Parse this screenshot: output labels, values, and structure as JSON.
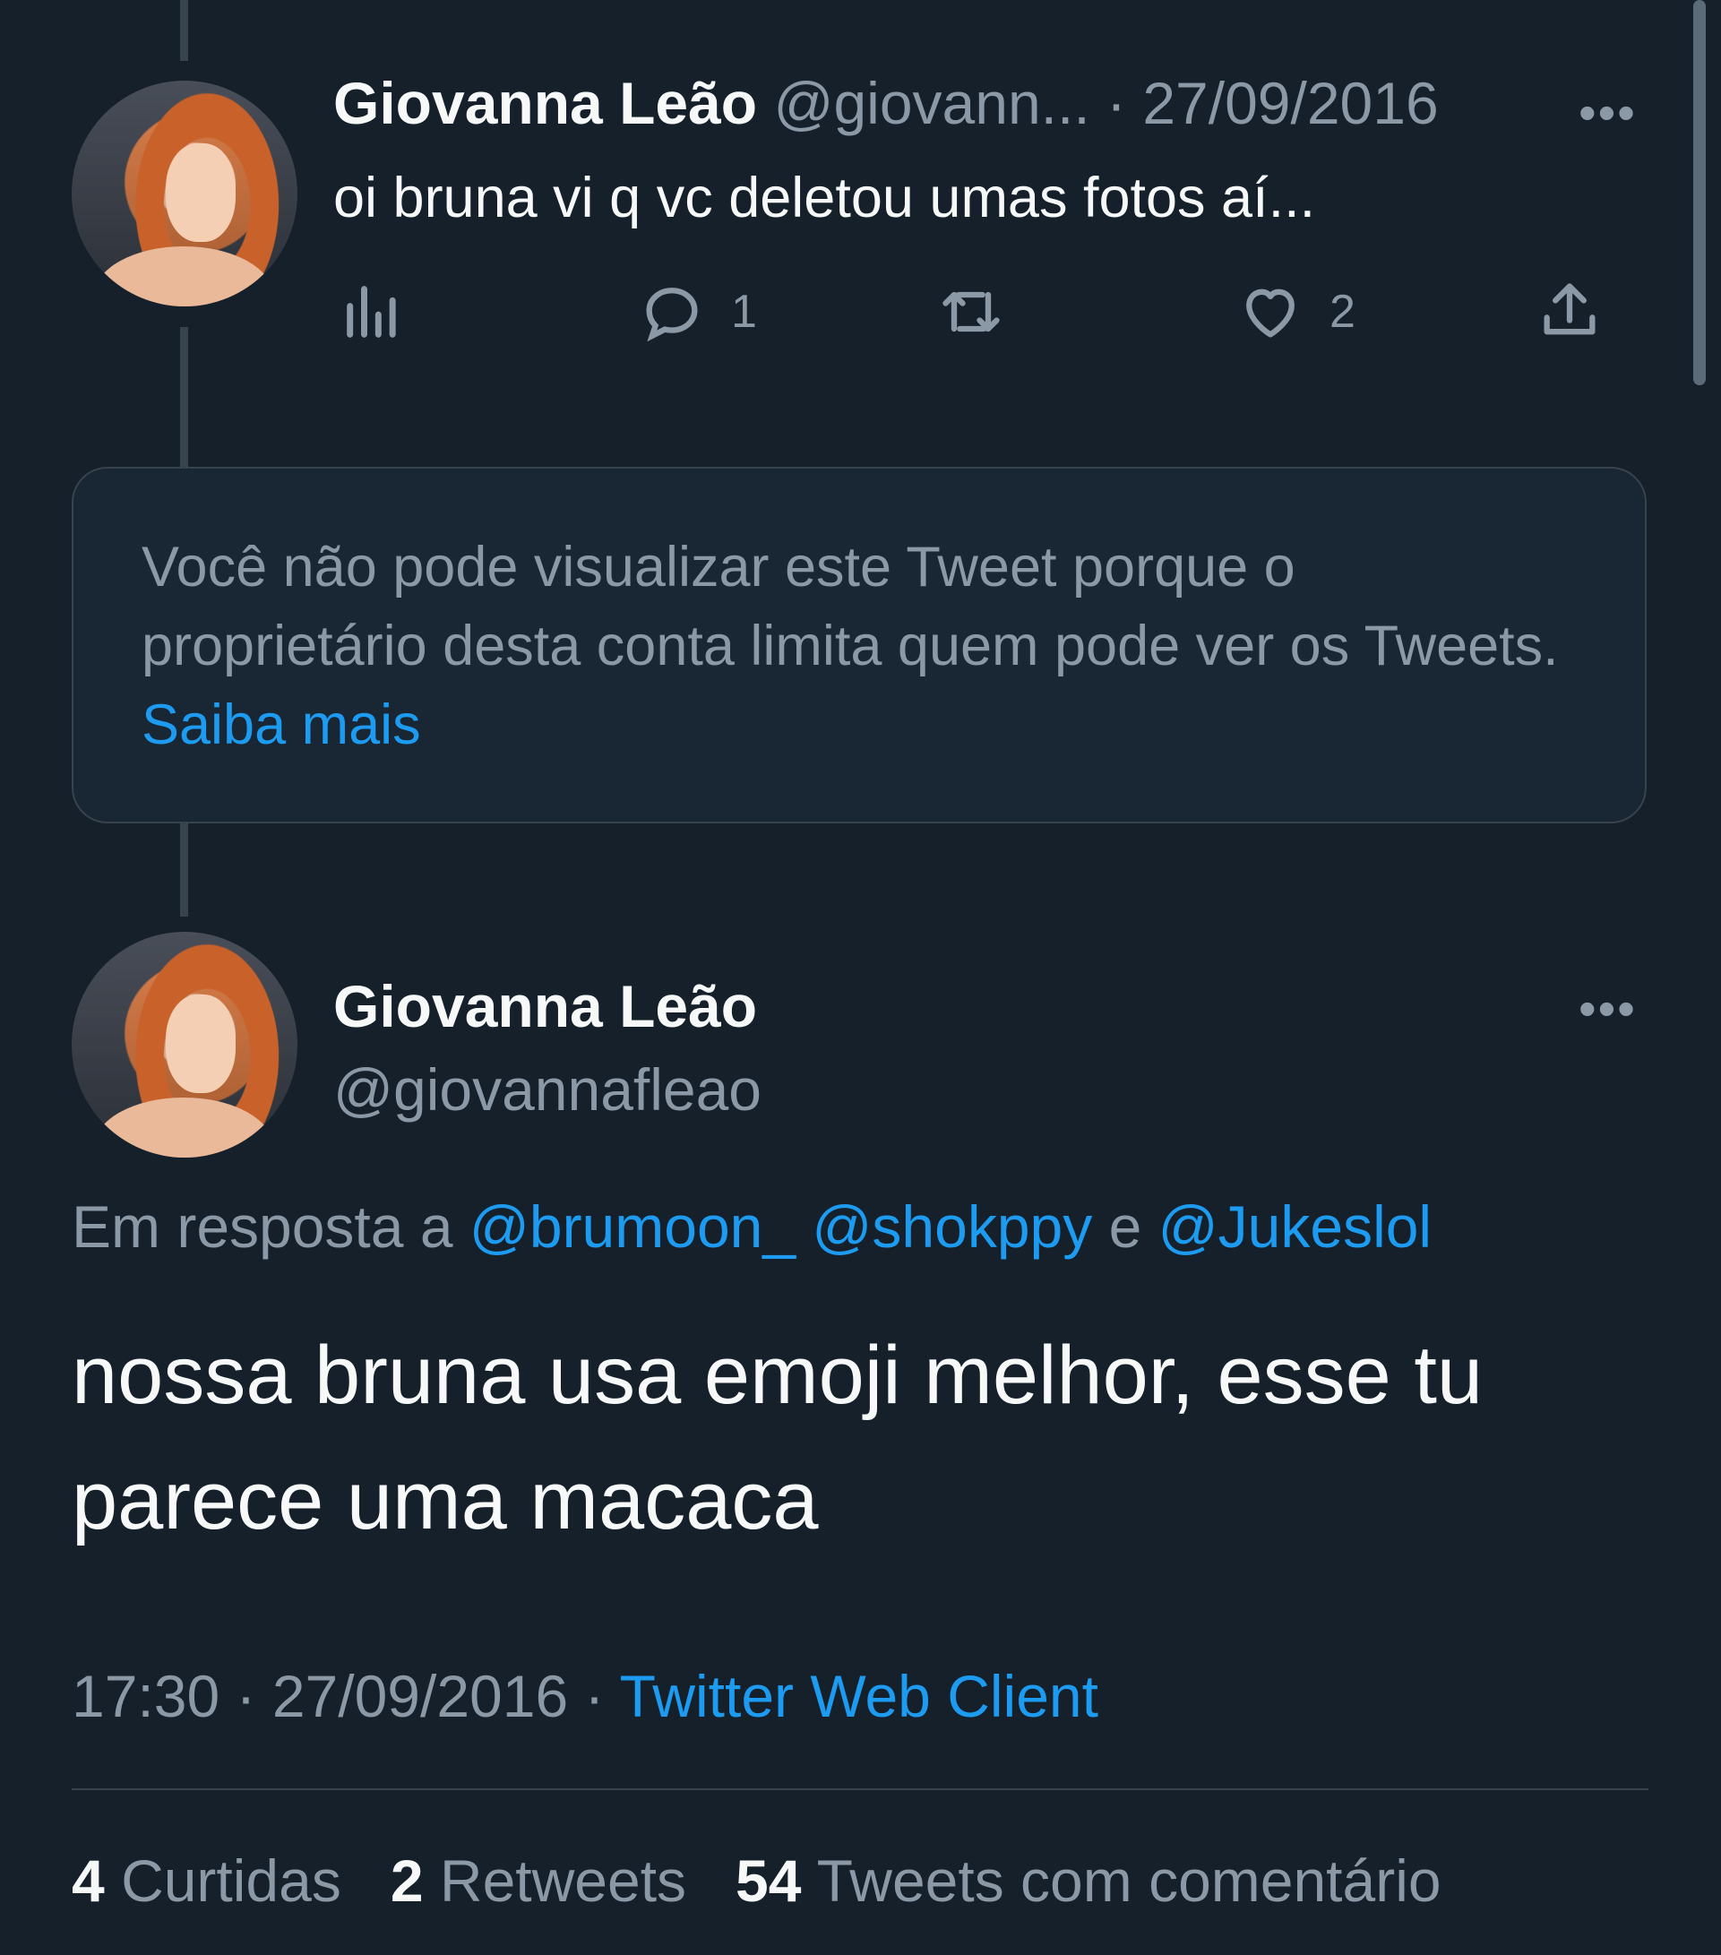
{
  "tweet1": {
    "name": "Giovanna Leão",
    "handle": "@giovann...",
    "date": "· 27/09/2016",
    "text": "oi bruna vi q vc deletou umas fotos aí...",
    "replies": "1",
    "likes": "2",
    "more": "•••"
  },
  "restricted": {
    "message": "Você não pode visualizar este Tweet porque o proprietário desta conta limita quem pode ver os Tweets.",
    "link": "Saiba mais"
  },
  "tweet2": {
    "name": "Giovanna Leão",
    "handle": "@giovannafleao",
    "more": "•••",
    "reply_prefix": "Em resposta a",
    "mention1": "@brumoon_",
    "mention2": "@shokppy",
    "reply_conj": "e",
    "mention3": "@Jukeslol",
    "text": "nossa bruna usa emoji melhor, esse tu parece uma macaca",
    "time": "17:30",
    "date": "27/09/2016",
    "source": "Twitter Web Client",
    "likes_count": "4",
    "likes_label": "Curtidas",
    "retweets_count": "2",
    "retweets_label": "Retweets",
    "quotes_count": "54",
    "quotes_label": "Tweets com comentário"
  },
  "icons": [
    "analytics-icon",
    "reply-icon",
    "retweet-icon",
    "like-icon",
    "share-icon",
    "more-icon"
  ],
  "colors": {
    "background": "#15202b",
    "muted": "#8b98a5",
    "link": "#1d9bf0",
    "border": "#38444d"
  }
}
